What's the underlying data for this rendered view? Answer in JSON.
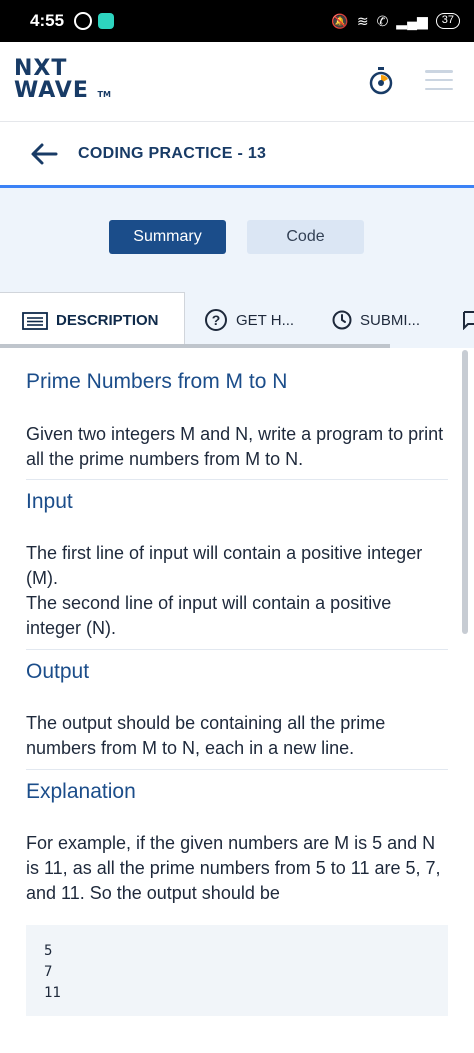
{
  "status_bar": {
    "time": "4:55",
    "battery": "37"
  },
  "header": {
    "logo_line1": "NXT",
    "logo_line2": "WAVE",
    "logo_tm": "TM"
  },
  "title_bar": {
    "title": "CODING PRACTICE - 13"
  },
  "toggle": {
    "summary_label": "Summary",
    "code_label": "Code"
  },
  "tabs": [
    {
      "label": "DESCRIPTION",
      "icon": "description-icon"
    },
    {
      "label": "GET H...",
      "icon": "help-circle-icon"
    },
    {
      "label": "SUBMI...",
      "icon": "clock-icon"
    }
  ],
  "problem": {
    "title": "Prime Numbers from M to N",
    "statement": "Given two integers M and N, write a program to print all the prime numbers from M to N.",
    "input_heading": "Input",
    "input_text_1": "The first line of input will contain a positive integer (M).",
    "input_text_2": "The second line of input will contain a positive integer (N).",
    "output_heading": "Output",
    "output_text": "The output should be containing all the prime numbers from M to N, each in a new line.",
    "explanation_heading": "Explanation",
    "explanation_text": "For example, if the given numbers are M is 5 and N is 11, as all the prime numbers from 5 to 11 are 5, 7, and 11. So the output should be",
    "example_output": [
      "5",
      "7",
      "11"
    ]
  },
  "colors": {
    "brand_navy": "#1b4d8a",
    "accent_blue": "#3b82f6",
    "band_bg": "#eef4fb"
  }
}
